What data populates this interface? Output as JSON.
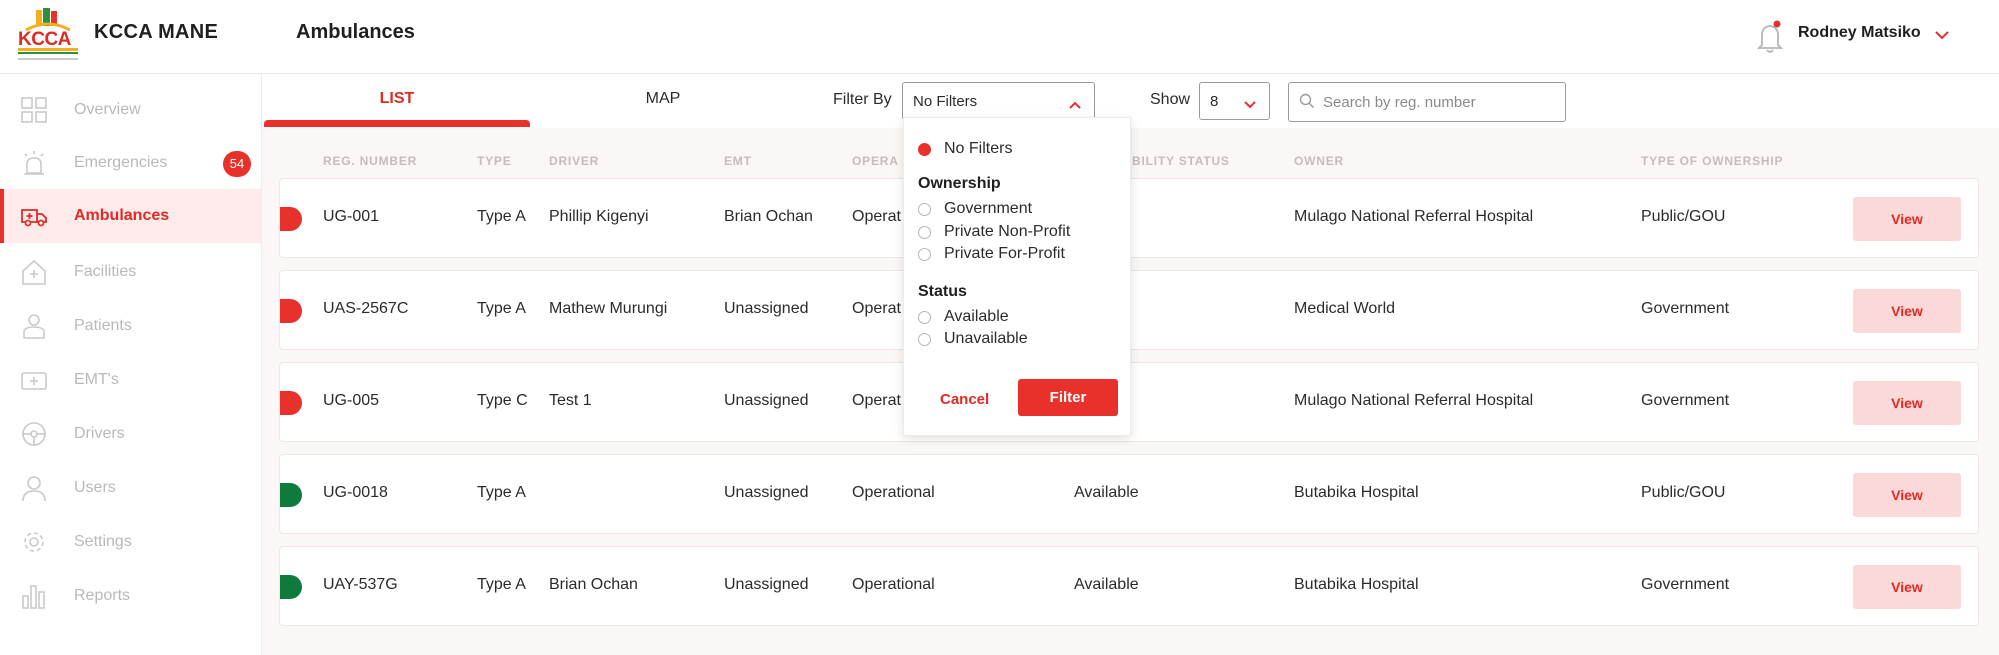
{
  "header": {
    "logo_text": "KCCA",
    "brand": "KCCA MANE",
    "page_title": "Ambulances",
    "user_name": "Rodney Matsiko",
    "notification_dot_color": "#e8312b"
  },
  "sidebar": {
    "items": [
      {
        "label": "Overview",
        "icon": "grid-icon"
      },
      {
        "label": "Emergencies",
        "icon": "siren-icon",
        "badge": "54"
      },
      {
        "label": "Ambulances",
        "icon": "ambulance-icon",
        "active": true
      },
      {
        "label": "Facilities",
        "icon": "facility-icon"
      },
      {
        "label": "Patients",
        "icon": "patient-icon"
      },
      {
        "label": "EMT's",
        "icon": "emt-icon"
      },
      {
        "label": "Drivers",
        "icon": "steering-wheel-icon"
      },
      {
        "label": "Users",
        "icon": "user-icon"
      },
      {
        "label": "Settings",
        "icon": "gear-icon"
      },
      {
        "label": "Reports",
        "icon": "bar-chart-icon"
      }
    ]
  },
  "toolbar": {
    "tabs": [
      {
        "label": "LIST",
        "active": true
      },
      {
        "label": "MAP",
        "active": false
      }
    ],
    "filter_label": "Filter By",
    "filter_value": "No Filters",
    "show_label": "Show",
    "show_value": "8",
    "search_placeholder": "Search by reg. number"
  },
  "table": {
    "columns": [
      "REG. NUMBER",
      "TYPE",
      "DRIVER",
      "EMT",
      "OPERATIONAL STATUS",
      "AVAILABILITY STATUS",
      "OWNER",
      "TYPE OF OWNERSHIP"
    ],
    "visible_column_headers": [
      "REG. NUMBER",
      "TYPE",
      "DRIVER",
      "EMT",
      "OPERA",
      "BILITY STATUS",
      "OWNER",
      "TYPE OF OWNERSHIP"
    ],
    "view_label": "View",
    "rows": [
      {
        "reg": "UG-001",
        "type": "Type A",
        "driver": "Phillip Kigenyi",
        "emt": "Brian Ochan",
        "op_status": "Operat",
        "availability": "",
        "owner": "Mulago National Referral Hospital",
        "ownership": "Public/GOU",
        "marker_color": "#e8312b"
      },
      {
        "reg": "UAS-2567C",
        "type": "Type A",
        "driver": "Mathew Murungi",
        "emt": "Unassigned",
        "op_status": "Operat",
        "availability": "",
        "owner": "Medical World",
        "ownership": "Government",
        "marker_color": "#e8312b"
      },
      {
        "reg": "UG-005",
        "type": "Type C",
        "driver": "Test 1",
        "emt": "Unassigned",
        "op_status": "Operat",
        "availability": "",
        "owner": "Mulago National Referral Hospital",
        "ownership": "Government",
        "marker_color": "#e8312b"
      },
      {
        "reg": "UG-0018",
        "type": "Type A",
        "driver": "",
        "emt": "Unassigned",
        "op_status": "Operational",
        "availability": "Available",
        "owner": "Butabika Hospital",
        "ownership": "Public/GOU",
        "marker_color": "#0e7a3c"
      },
      {
        "reg": "UAY-537G",
        "type": "Type A",
        "driver": "Brian Ochan",
        "emt": "Unassigned",
        "op_status": "Operational",
        "availability": "Available",
        "owner": "Butabika Hospital",
        "ownership": "Government",
        "marker_color": "#0e7a3c"
      }
    ]
  },
  "filter_dropdown": {
    "no_filters": "No Filters",
    "ownership_heading": "Ownership",
    "ownership_options": [
      "Government",
      "Private Non-Profit",
      "Private For-Profit"
    ],
    "status_heading": "Status",
    "status_options": [
      "Available",
      "Unavailable"
    ],
    "cancel_label": "Cancel",
    "filter_label": "Filter"
  },
  "colors": {
    "accent": "#e8312b",
    "active_bg": "#fdeaea",
    "view_bg": "#fcd9d9",
    "available": "#0e7a3c"
  }
}
